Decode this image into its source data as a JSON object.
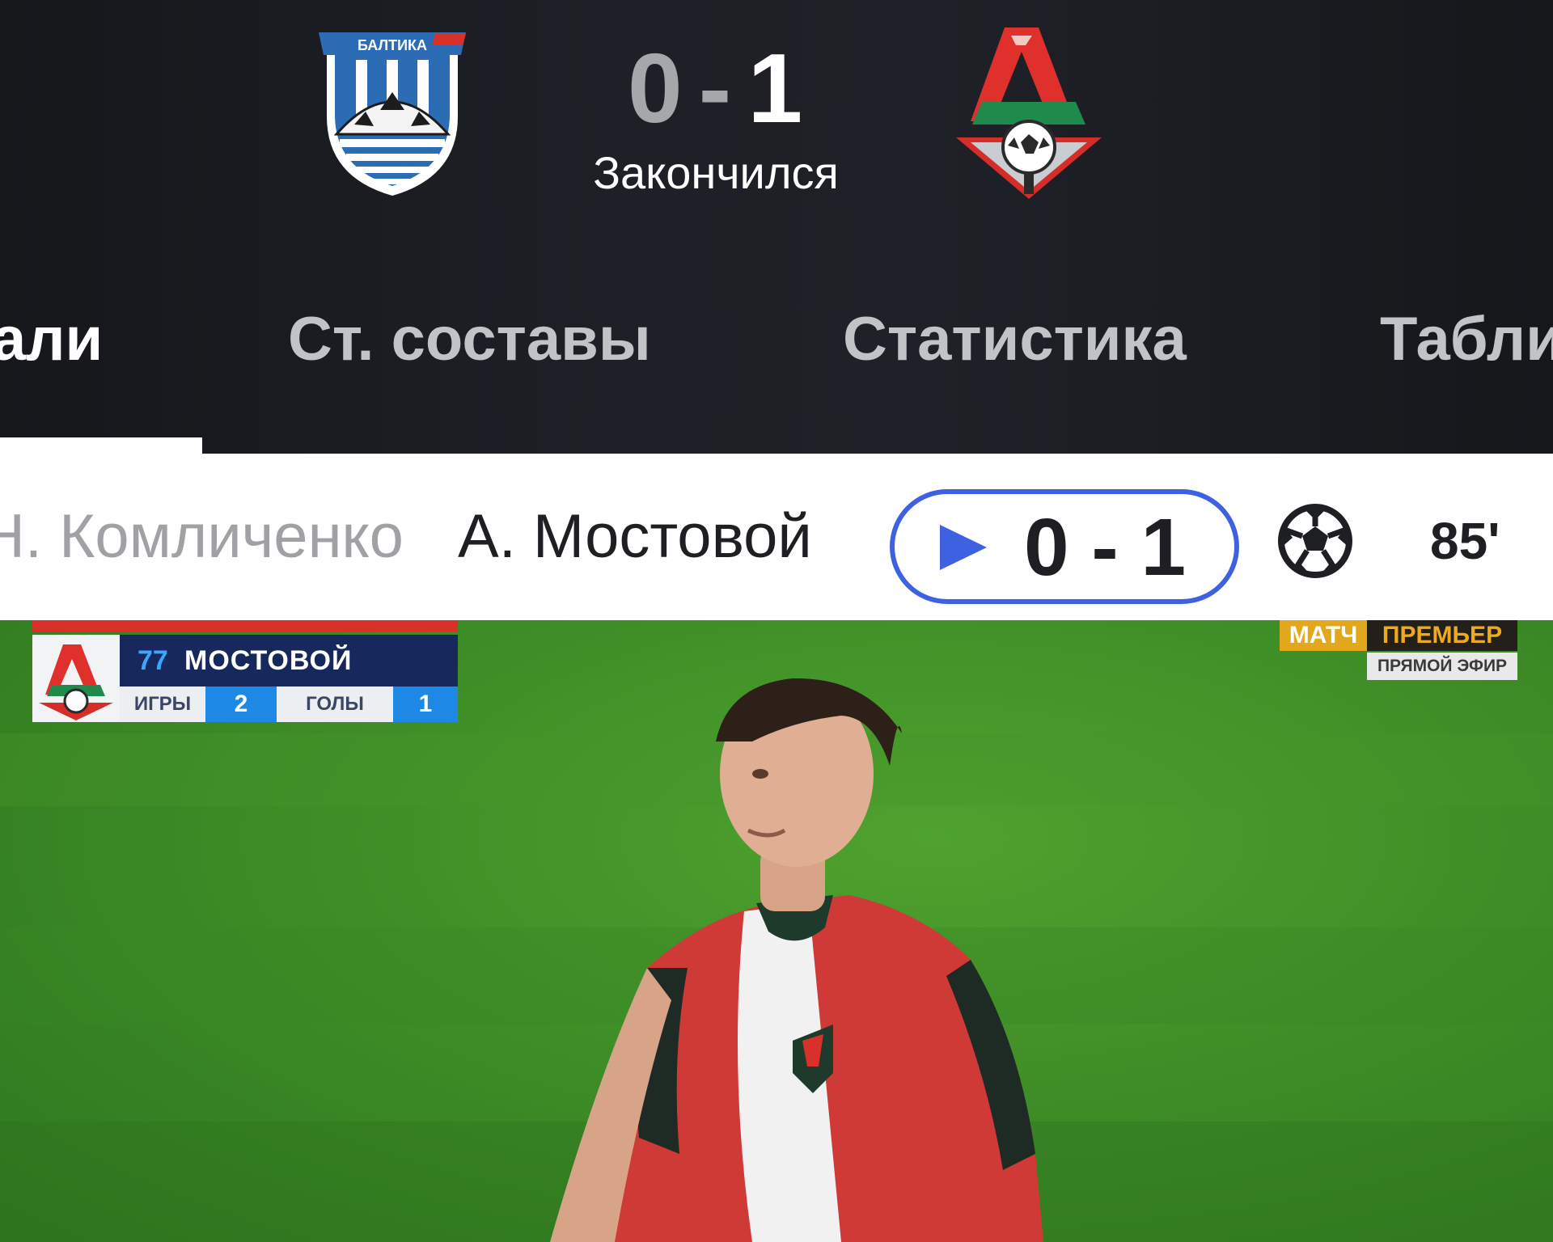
{
  "match": {
    "home_score": "0",
    "separator": "-",
    "away_score": "1",
    "status": "Закончился",
    "home_logo_text": "БАЛТИКА"
  },
  "tabs": [
    {
      "label": "Детали",
      "visible_text": "али",
      "active": true
    },
    {
      "label": "Ст. составы"
    },
    {
      "label": "Статистика"
    },
    {
      "label": "Таблица",
      "visible_text": "Табли"
    }
  ],
  "event": {
    "assist": "Н. Комличенко",
    "scorer": "А. Мостовой",
    "score": "0 - 1",
    "minute": "85'",
    "icons": [
      "play-icon",
      "soccer-ball-icon"
    ],
    "accent_color": "#3e61e2"
  },
  "video": {
    "tv_overlay": {
      "number": "77",
      "player": "МОСТОВОЙ",
      "games_label": "ИГРЫ",
      "games_value": "2",
      "goals_label": "ГОЛЫ",
      "goals_value": "1"
    },
    "broadcaster": {
      "match": "МАТЧ",
      "premier": "ПРЕМЬЕР",
      "live": "ПРЯМОЙ ЭФИР"
    }
  }
}
